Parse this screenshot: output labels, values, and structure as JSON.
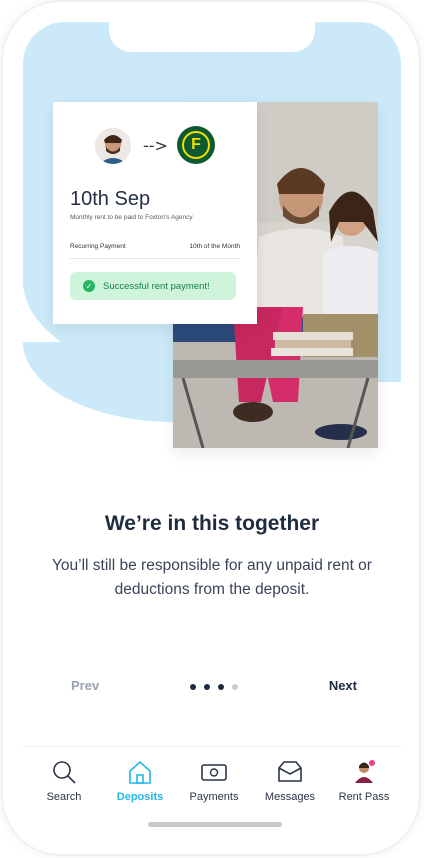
{
  "card": {
    "date": "10th Sep",
    "subtitle": "Monthly rent to be paid to Foxton's Agency",
    "recurring_label": "Recurring Payment",
    "recurring_value": "10th of the Month",
    "success_text": "Successful rent payment!",
    "arrow": "-->",
    "logo_letter": "F"
  },
  "content": {
    "headline": "We’re in this together",
    "body": "You’ll still be responsible for any unpaid rent or deductions from the deposit."
  },
  "pager": {
    "prev_label": "Prev",
    "next_label": "Next",
    "total_pages": 4,
    "current_page": 3
  },
  "tabs": [
    {
      "label": "Search",
      "icon": "search-icon"
    },
    {
      "label": "Deposits",
      "icon": "home-icon",
      "active": true
    },
    {
      "label": "Payments",
      "icon": "payments-icon"
    },
    {
      "label": "Messages",
      "icon": "inbox-icon"
    },
    {
      "label": "Rent Pass",
      "icon": "profile-avatar-icon"
    }
  ],
  "colors": {
    "accent": "#23b7e5",
    "hero_bg": "#cbe9f8",
    "success_bg": "#cff4dc",
    "success_text": "#178043",
    "dark_text": "#1f2b3f"
  }
}
